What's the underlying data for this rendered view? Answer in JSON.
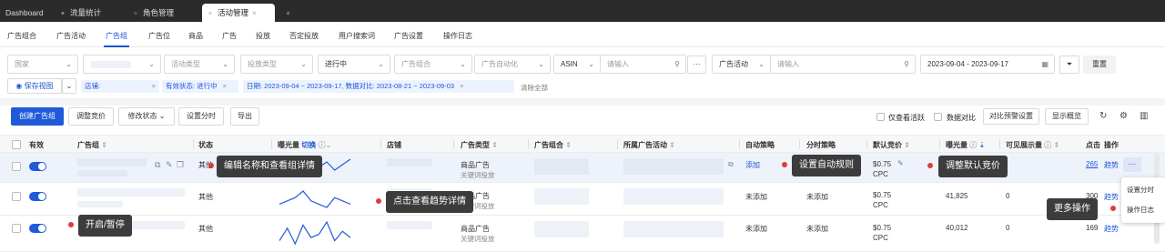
{
  "tabs": [
    {
      "label": "Dashboard",
      "icon": ""
    },
    {
      "label": "流量统计",
      "icon": "pin-icon"
    },
    {
      "label": "角色管理",
      "icon": "pin-outline-icon"
    },
    {
      "label": "活动管理",
      "icon": "pin-outline-icon"
    }
  ],
  "nav": [
    "广告组合",
    "广告活动",
    "广告组",
    "广告位",
    "商品",
    "广告",
    "投放",
    "否定投放",
    "用户搜索词",
    "广告设置",
    "操作日志"
  ],
  "filters": {
    "country": "国家",
    "campaign_type": "活动类型",
    "targeting_type": "投放类型",
    "status": "进行中",
    "portfolio": "广告组合",
    "automation": "广告自动化",
    "asin_label": "ASIN",
    "asin_placeholder": "请输入",
    "more": "···",
    "campaign_label": "广告活动",
    "campaign_placeholder": "请输入",
    "date_start": "2023-09-04",
    "date_sep": "-",
    "date_end": "2023-09-17",
    "reset": "重置"
  },
  "chips": {
    "saved_view": "保存视图",
    "store": "店铺:",
    "status": "有效状态: 进行中",
    "date": "日期: 2023-09-04 ~ 2023-09-17, 数据对比: 2023-08-21 ~ 2023-09-03",
    "clear": "清除全部"
  },
  "actions": {
    "create": "创建广告组",
    "adjust_bid": "调整竞价",
    "modify_status": "修改状态",
    "set_schedule": "设置分时",
    "export": "导出",
    "only_active": "仅查看活跃",
    "data_compare": "数据对比",
    "compare_alert": "对比预警设置",
    "show_summary": "显示概览"
  },
  "columns": {
    "active": "有效",
    "ad_group": "广告组",
    "status": "状态",
    "impressions": "曝光量",
    "switch": "切换",
    "store": "店铺",
    "ad_type": "广告类型",
    "portfolio": "广告组合",
    "campaign": "所属广告活动",
    "auto_strategy": "自动策略",
    "schedule_strategy": "分时策略",
    "default_bid": "默认竞价",
    "impressions2": "曝光量",
    "visible_impr": "可见展示量",
    "clicks": "点击",
    "ops": "操作"
  },
  "rows": [
    {
      "status": "其他",
      "ad_type": "商品广告",
      "ad_type_sub": "关键词投放",
      "auto": "添加",
      "bid": "$0.75",
      "bid_sub": "CPC",
      "impr": "",
      "visible": "",
      "clicks": "265",
      "trend": "趋势",
      "more": "···",
      "spark": [
        6,
        5,
        7,
        4,
        3,
        6,
        8,
        5,
        7,
        9
      ]
    },
    {
      "status": "其他",
      "ad_type": "商品广告",
      "ad_type_sub": "关键词投放",
      "auto": "未添加",
      "schedule": "未添加",
      "bid": "$0.75",
      "bid_sub": "CPC",
      "impr": "41,825",
      "visible": "0",
      "clicks": "300",
      "trend": "趋势",
      "spark": [
        4,
        5,
        6,
        8,
        5,
        4,
        3,
        6,
        5,
        4
      ]
    },
    {
      "status": "其他",
      "ad_type": "商品广告",
      "ad_type_sub": "关键词投放",
      "auto": "未添加",
      "schedule": "未添加",
      "bid": "$0.75",
      "bid_sub": "CPC",
      "impr": "40,012",
      "visible": "0",
      "clicks": "169",
      "trend": "趋势",
      "spark": [
        3,
        7,
        2,
        8,
        4,
        5,
        9,
        3,
        6,
        4
      ]
    }
  ],
  "tips": {
    "edit": "编辑名称和查看组详情",
    "auto_rule": "设置自动规则",
    "default_bid": "调整默认竞价",
    "trend": "点击查看趋势详情",
    "toggle": "开启/暂停",
    "more_ops": "更多操作"
  },
  "more_menu": [
    "设置分时",
    "操作日志"
  ],
  "colors": {
    "accent": "#1f5ad9",
    "tooltip": "#3c3c3c",
    "marker": "#e03a3a"
  }
}
